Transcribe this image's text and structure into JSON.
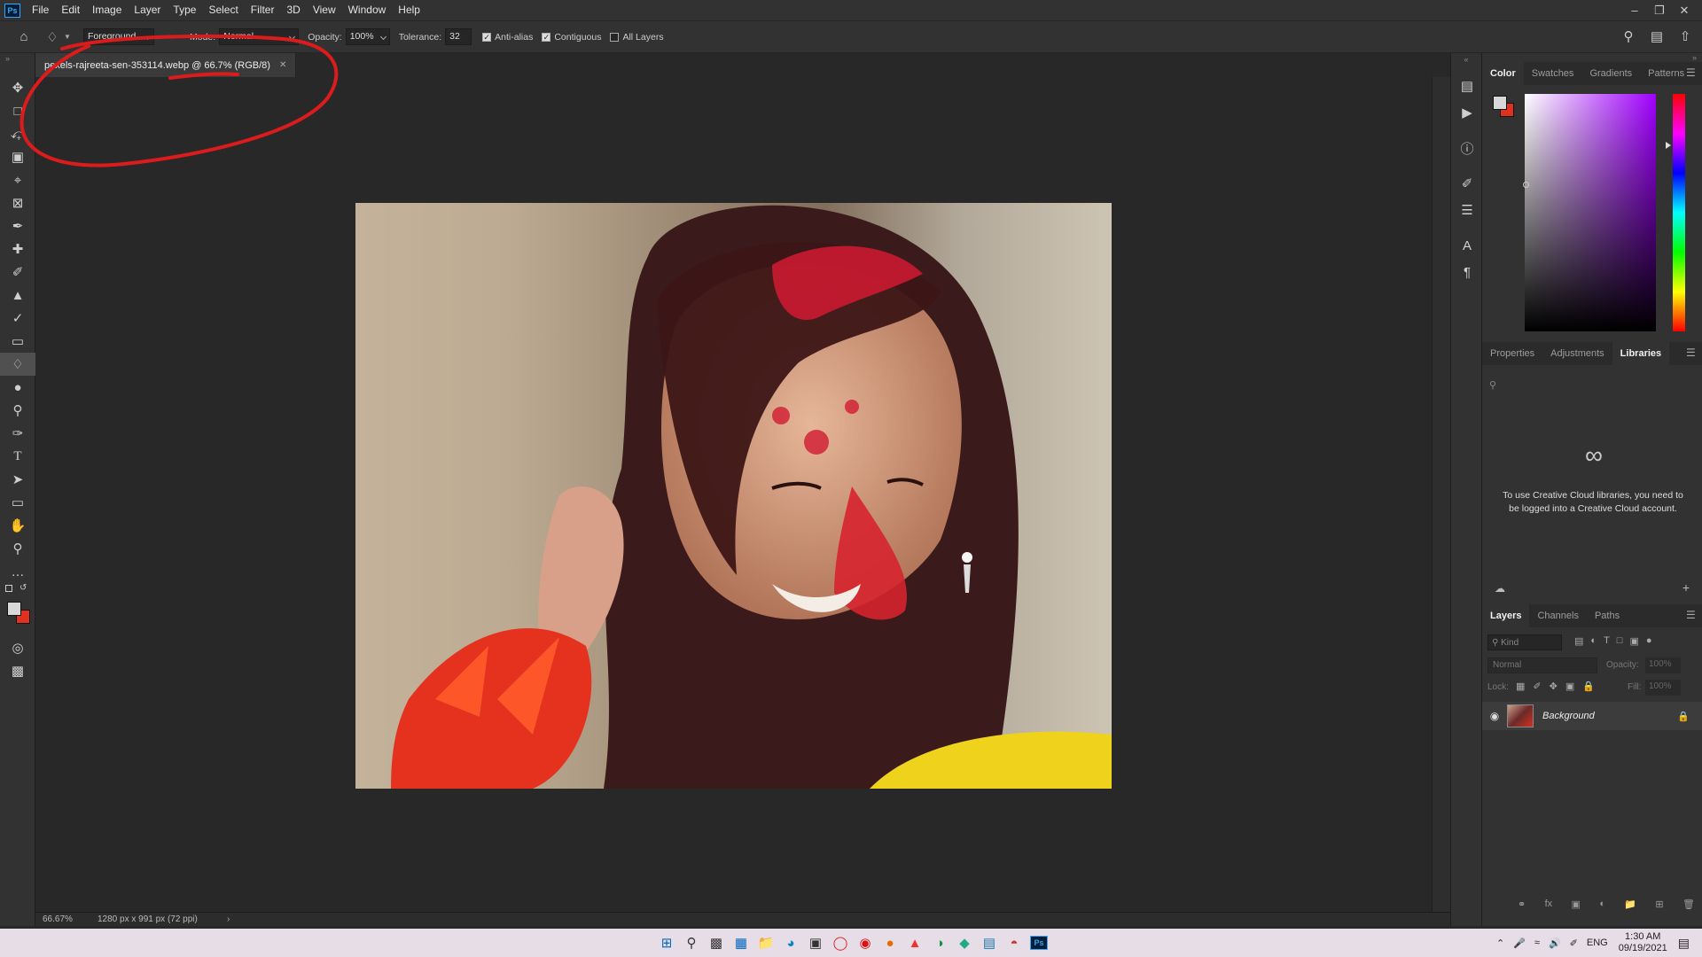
{
  "app": {
    "logo": "Ps"
  },
  "menubar": {
    "items": [
      "File",
      "Edit",
      "Image",
      "Layer",
      "Type",
      "Select",
      "Filter",
      "3D",
      "View",
      "Window",
      "Help"
    ]
  },
  "options": {
    "fill_source": "Foreground",
    "mode_label": "Mode:",
    "mode_value": "Normal",
    "opacity_label": "Opacity:",
    "opacity_value": "100%",
    "tolerance_label": "Tolerance:",
    "tolerance_value": "32",
    "antialias_label": "Anti-alias",
    "antialias_checked": true,
    "contiguous_label": "Contiguous",
    "contiguous_checked": true,
    "all_layers_label": "All Layers",
    "all_layers_checked": false
  },
  "document": {
    "tab_title": "pexels-rajreeta-sen-353114.webp @ 66.7% (RGB/8)"
  },
  "status": {
    "zoom": "66.67%",
    "doc_info": "1280 px x 991 px (72 ppi)"
  },
  "color_panel": {
    "tabs": [
      "Color",
      "Swatches",
      "Gradients",
      "Patterns"
    ],
    "selected": "Color",
    "foreground": "#d8d8d8",
    "background": "#e0301e"
  },
  "libraries_panel": {
    "tabs": [
      "Properties",
      "Adjustments",
      "Libraries"
    ],
    "selected": "Libraries",
    "message": "To use Creative Cloud libraries, you need to be logged into a Creative Cloud account."
  },
  "layers_panel": {
    "tabs": [
      "Layers",
      "Channels",
      "Paths"
    ],
    "selected": "Layers",
    "filter_placeholder": "Kind",
    "blend_mode": "Normal",
    "opacity_label": "Opacity:",
    "opacity_value": "100%",
    "lock_label": "Lock:",
    "fill_label": "Fill:",
    "fill_value": "100%",
    "layers": [
      {
        "name": "Background",
        "visible": true,
        "locked": true
      }
    ]
  },
  "taskbar": {
    "language": "ENG",
    "time": "1:30 AM",
    "date": "09/19/2021"
  },
  "colors": {
    "annotation": "#dc1c1c",
    "accent": "#31a8ff"
  }
}
